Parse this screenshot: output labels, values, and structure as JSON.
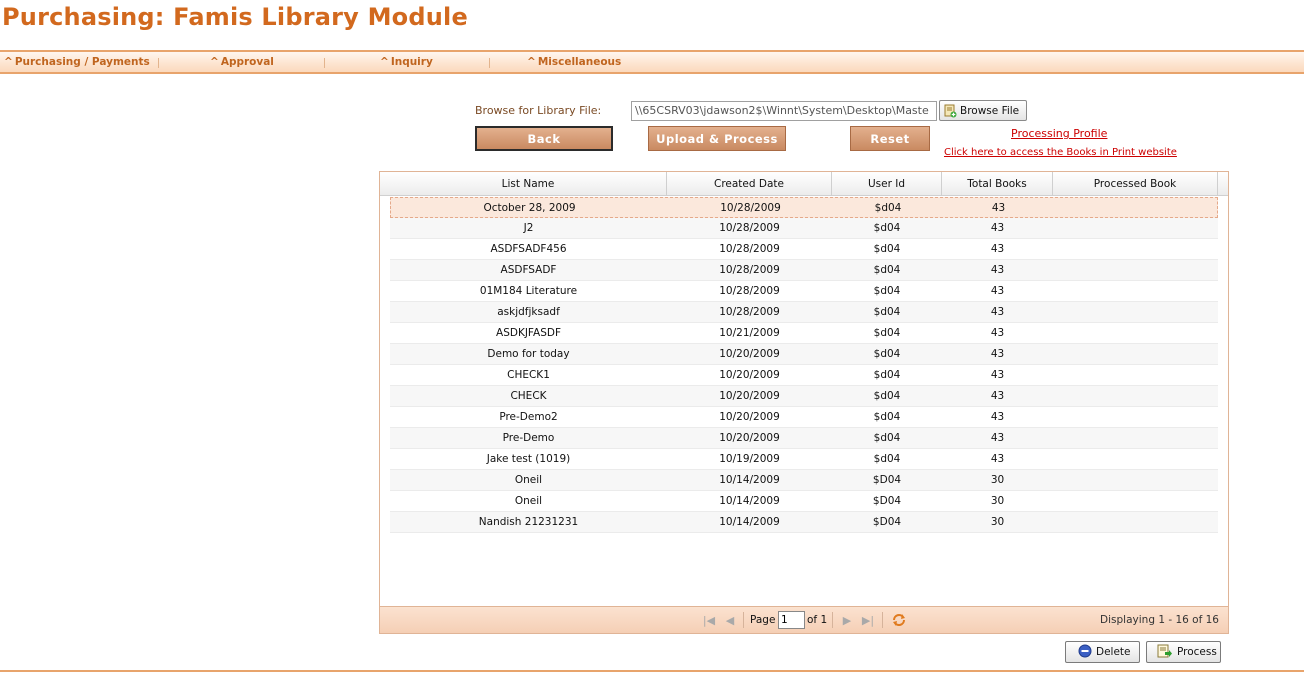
{
  "app": {
    "title": "Purchasing: Famis Library Module"
  },
  "menu": {
    "items": [
      {
        "label": "Purchasing / Payments"
      },
      {
        "label": "Approval"
      },
      {
        "label": "Inquiry"
      },
      {
        "label": "Miscellaneous"
      }
    ]
  },
  "upload": {
    "browse_label": "Browse for Library File:",
    "file_value": "\\\\65CSRV03\\jdawson2$\\Winnt\\System\\Desktop\\Maste",
    "browse_button": "Browse File",
    "back_button": "Back",
    "upload_button": "Upload & Process",
    "reset_button": "Reset",
    "processing_profile_link": "Processing Profile",
    "books_in_print_link": "Click here to access the Books in Print website"
  },
  "grid": {
    "columns": [
      "List Name",
      "Created Date",
      "User Id",
      "Total Books",
      "Processed Book"
    ],
    "rows": [
      [
        "October 28, 2009",
        "10/28/2009",
        "$d04",
        "43",
        ""
      ],
      [
        "J2",
        "10/28/2009",
        "$d04",
        "43",
        ""
      ],
      [
        "ASDFSADF456",
        "10/28/2009",
        "$d04",
        "43",
        ""
      ],
      [
        "ASDFSADF",
        "10/28/2009",
        "$d04",
        "43",
        ""
      ],
      [
        "01M184 Literature",
        "10/28/2009",
        "$d04",
        "43",
        ""
      ],
      [
        "askjdfjksadf",
        "10/28/2009",
        "$d04",
        "43",
        ""
      ],
      [
        "ASDKJFASDF",
        "10/21/2009",
        "$d04",
        "43",
        ""
      ],
      [
        "Demo for today",
        "10/20/2009",
        "$d04",
        "43",
        ""
      ],
      [
        "CHECK1",
        "10/20/2009",
        "$d04",
        "43",
        ""
      ],
      [
        "CHECK",
        "10/20/2009",
        "$d04",
        "43",
        ""
      ],
      [
        "Pre-Demo2",
        "10/20/2009",
        "$d04",
        "43",
        ""
      ],
      [
        "Pre-Demo",
        "10/20/2009",
        "$d04",
        "43",
        ""
      ],
      [
        "Jake test (1019)",
        "10/19/2009",
        "$d04",
        "43",
        ""
      ],
      [
        "Oneil",
        "10/14/2009",
        "$D04",
        "30",
        ""
      ],
      [
        "Oneil",
        "10/14/2009",
        "$D04",
        "30",
        ""
      ],
      [
        "Nandish 21231231",
        "10/14/2009",
        "$D04",
        "30",
        ""
      ]
    ]
  },
  "pager": {
    "page_label": "Page",
    "page_value": "1",
    "of_label": "of 1",
    "display_text": "Displaying 1 - 16 of 16"
  },
  "actions": {
    "delete_button": "Delete",
    "process_button": "Process"
  },
  "colors": {
    "accent": "#d2691e",
    "button": "#c98a61",
    "link": "#cc0000",
    "selected_row": "#fbe8dc"
  }
}
